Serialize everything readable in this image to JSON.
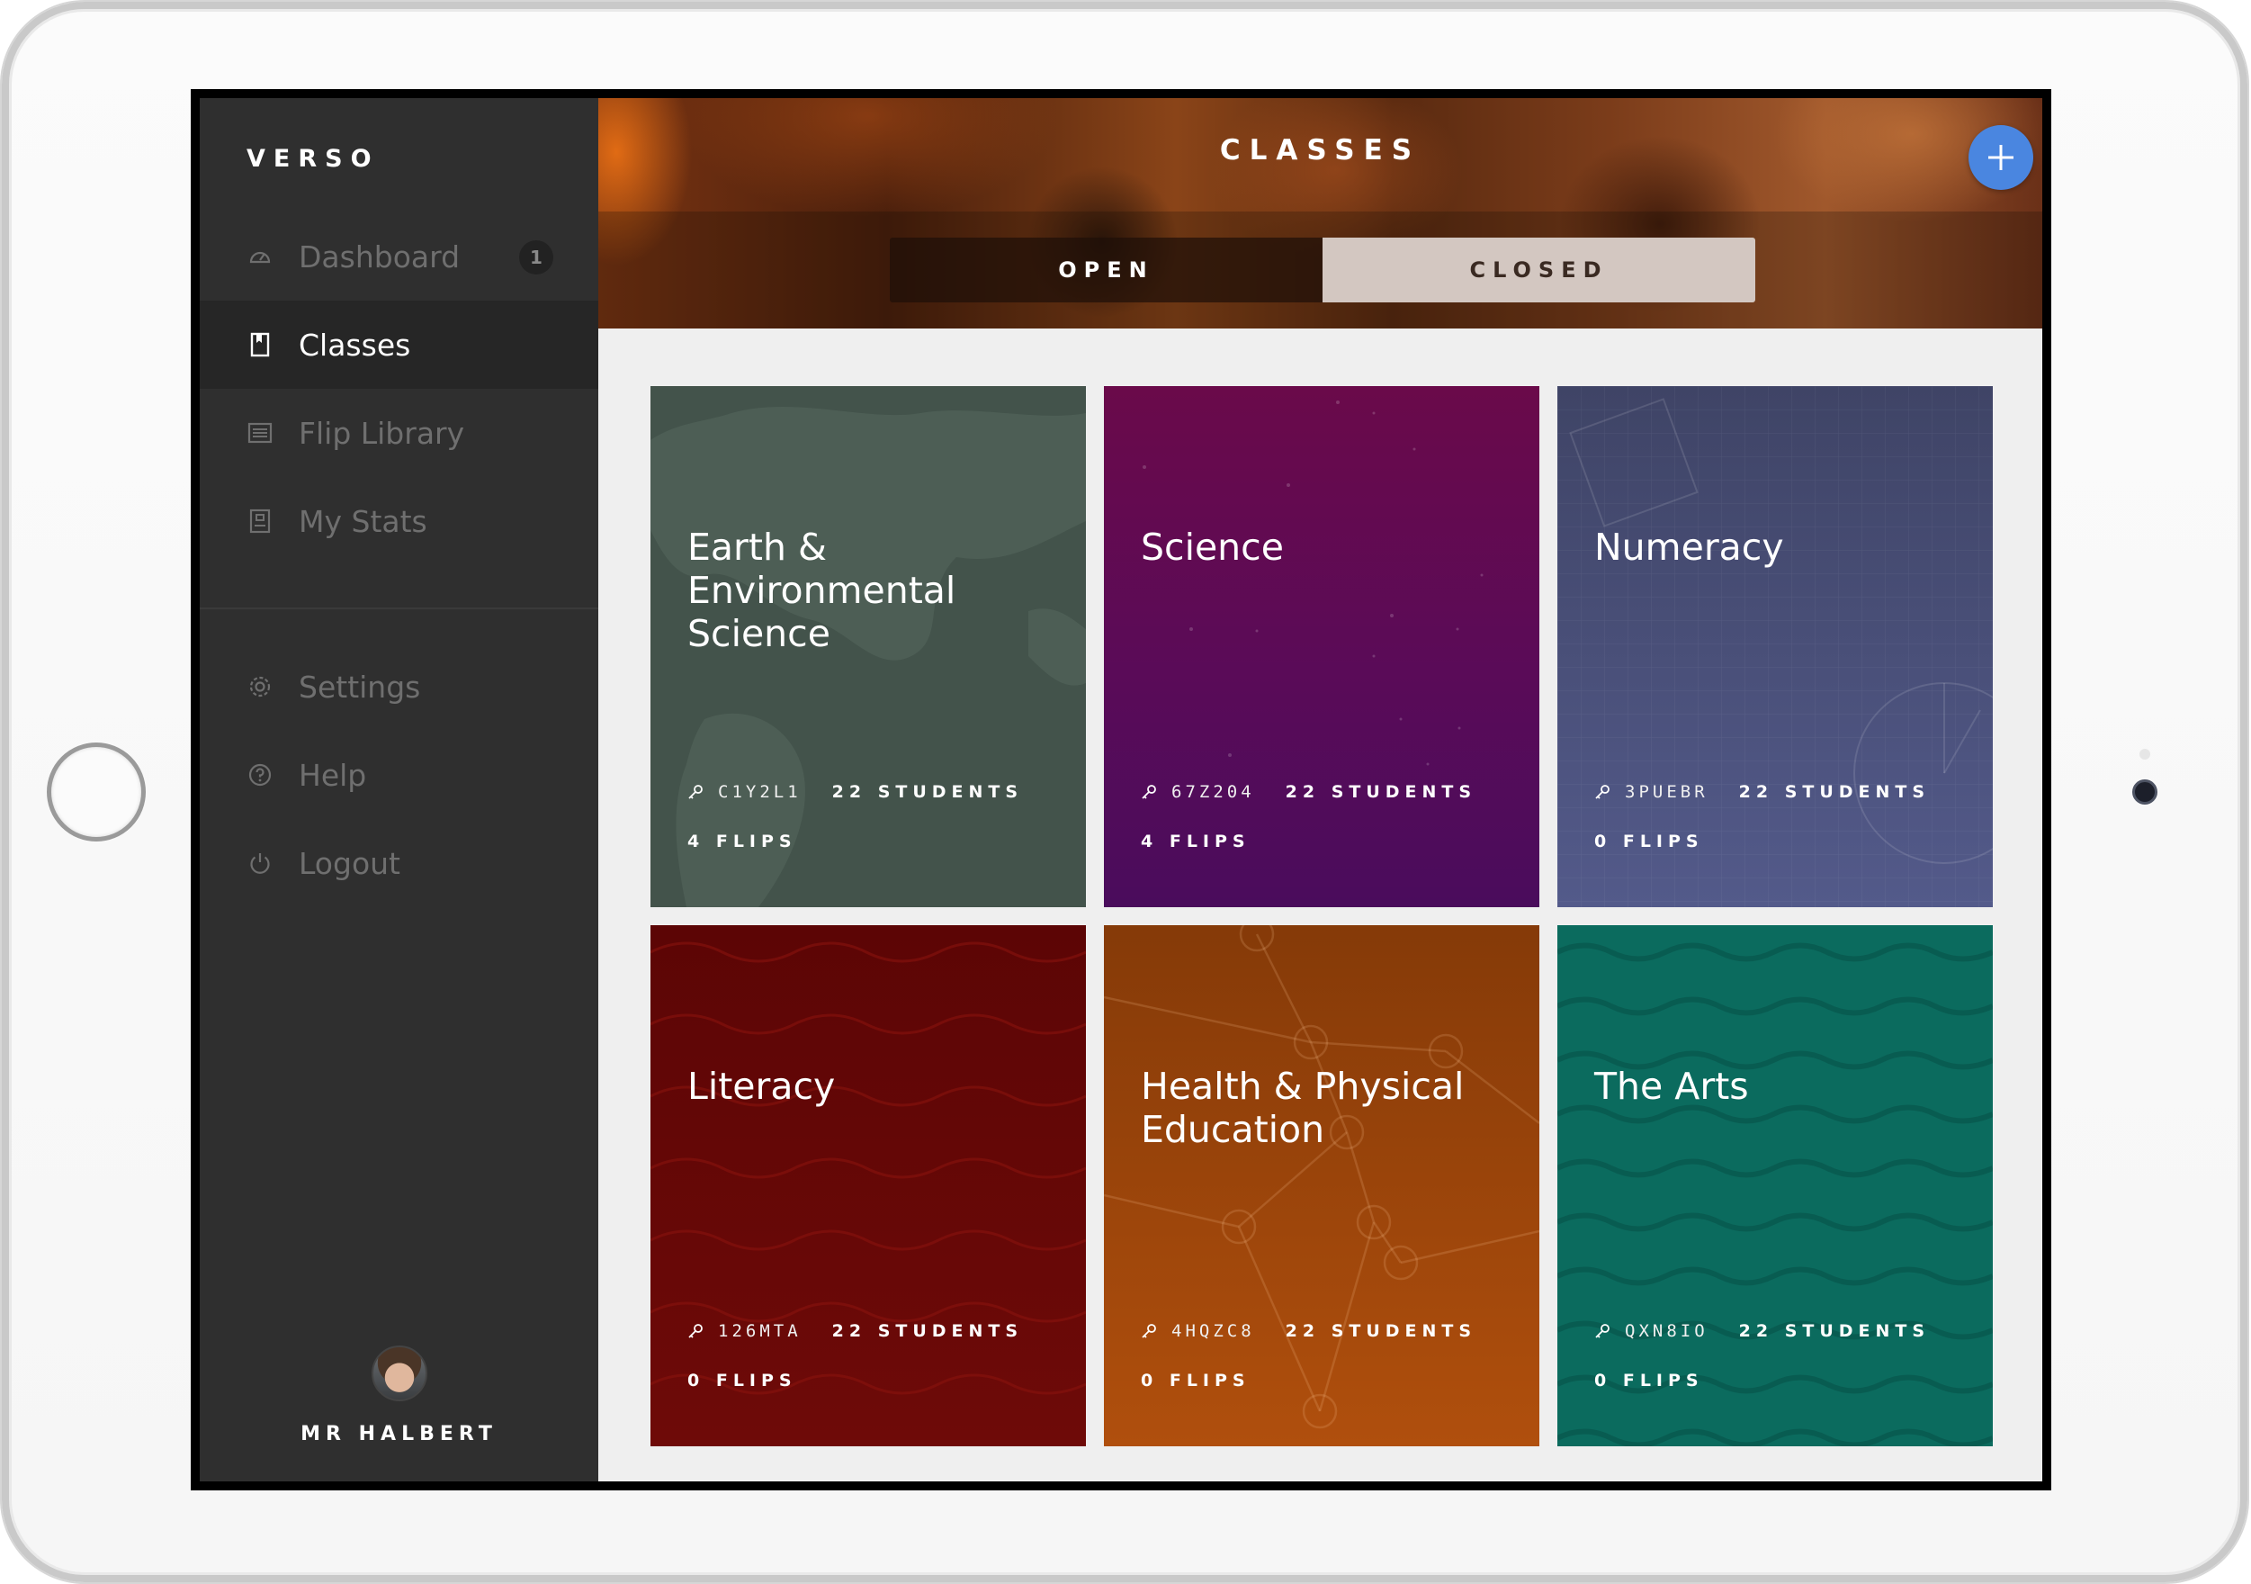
{
  "sidebar": {
    "brand": "VERSO",
    "nav": [
      {
        "label": "Dashboard",
        "icon": "dashboard-gauge-icon",
        "badge": "1",
        "active": false
      },
      {
        "label": "Classes",
        "icon": "book-icon",
        "active": true
      },
      {
        "label": "Flip Library",
        "icon": "list-icon",
        "active": false
      },
      {
        "label": "My Stats",
        "icon": "stats-icon",
        "active": false
      }
    ],
    "secondary": [
      {
        "label": "Settings",
        "icon": "gear-icon"
      },
      {
        "label": "Help",
        "icon": "help-icon"
      },
      {
        "label": "Logout",
        "icon": "power-icon"
      }
    ],
    "user": {
      "name": "MR HALBERT"
    }
  },
  "header": {
    "title": "CLASSES",
    "add_icon": "plus-icon",
    "tabs": [
      {
        "label": "OPEN",
        "selected": false
      },
      {
        "label": "CLOSED",
        "selected": true
      }
    ]
  },
  "classes": [
    {
      "title": "Earth & Environmental Science",
      "code": "C1Y2L1",
      "students": "22 STUDENTS",
      "flips": "4 FLIPS",
      "color": "#43534b"
    },
    {
      "title": "Science",
      "code": "67Z204",
      "students": "22 STUDENTS",
      "flips": "4 FLIPS",
      "color": "#5a0b58"
    },
    {
      "title": "Numeracy",
      "code": "3PUEBR",
      "students": "22 STUDENTS",
      "flips": "0 FLIPS",
      "color": "#4a5078"
    },
    {
      "title": "Literacy",
      "code": "126MTA",
      "students": "22 STUDENTS",
      "flips": "0 FLIPS",
      "color": "#650707"
    },
    {
      "title": "Health & Physical Education",
      "code": "4HQZC8",
      "students": "22 STUDENTS",
      "flips": "0 FLIPS",
      "color": "#9c4609"
    },
    {
      "title": "The Arts",
      "code": "QXN8IO",
      "students": "22 STUDENTS",
      "flips": "0 FLIPS",
      "color": "#0b6b5e"
    }
  ],
  "colors": {
    "sidebar_bg": "#2f2f2f",
    "accent": "#4a86e0"
  }
}
